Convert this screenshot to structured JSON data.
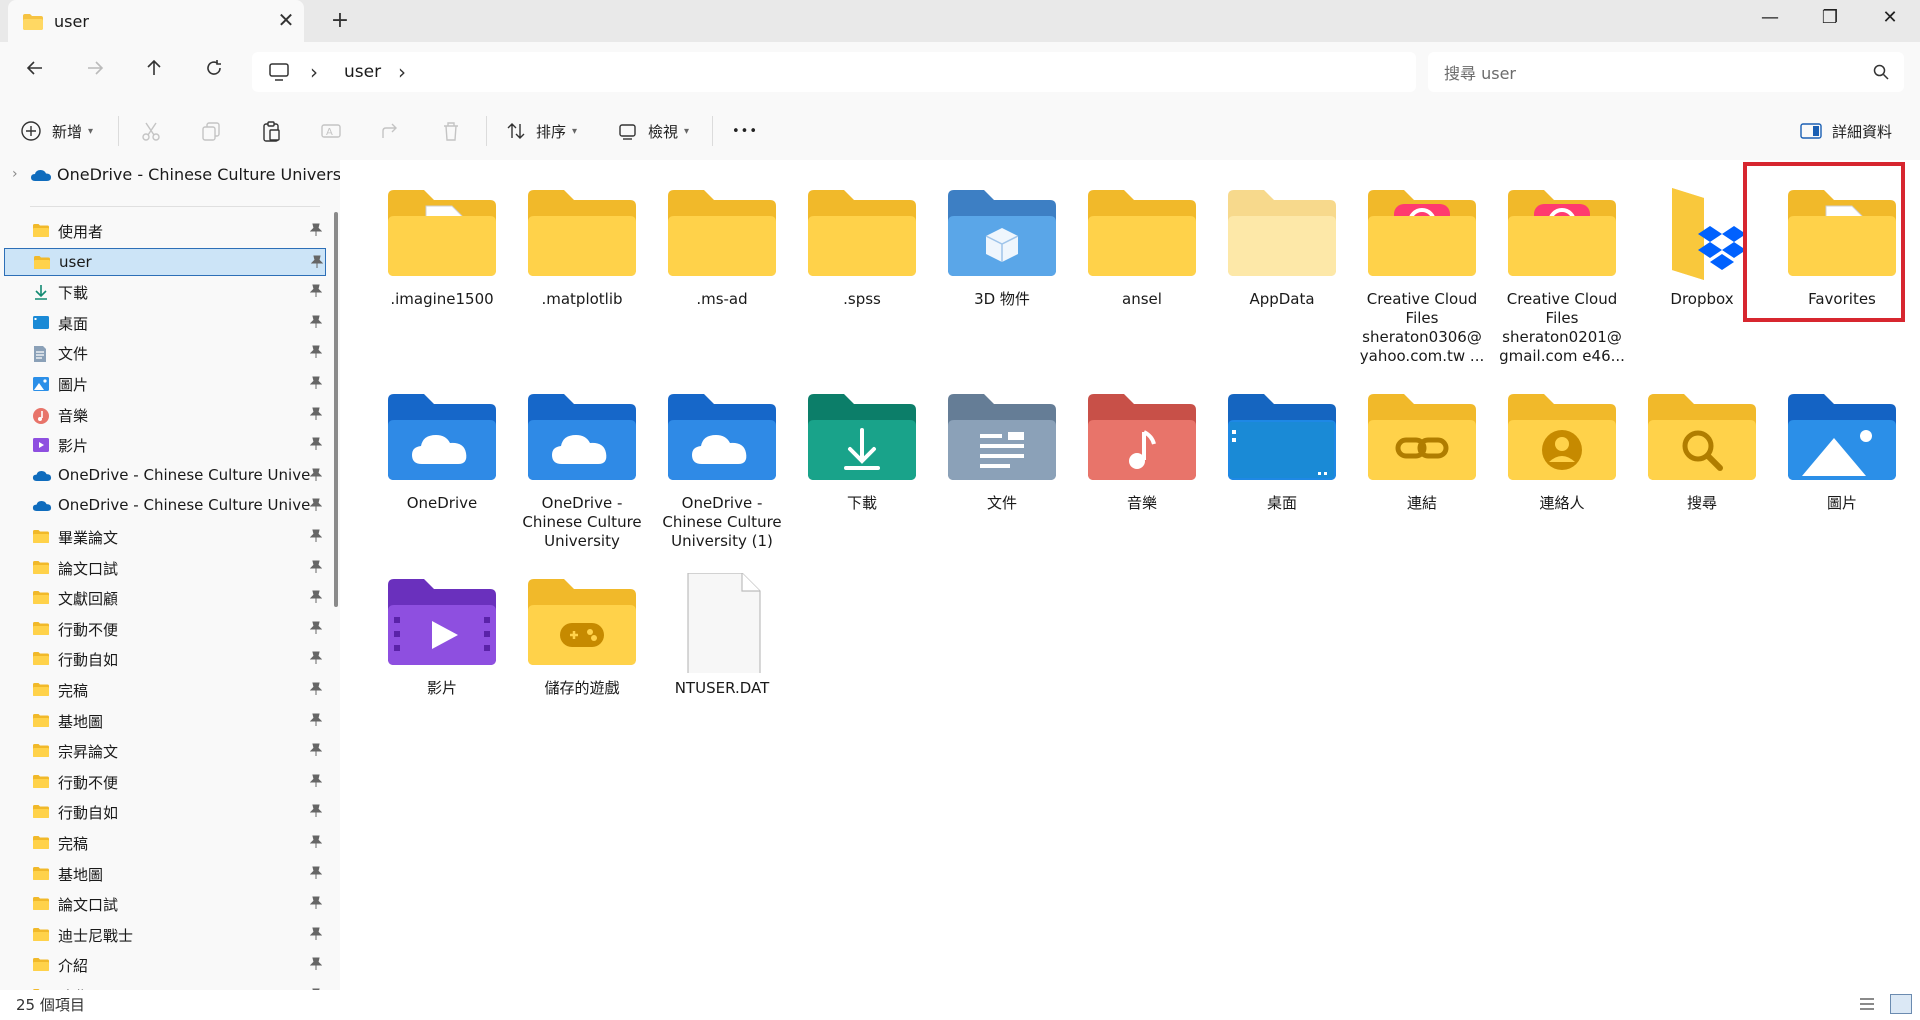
{
  "window": {
    "tab_title": "user",
    "new_tab": "+",
    "close_tab": "✕",
    "minimize": "—",
    "restore": "❐",
    "close": "✕"
  },
  "address": {
    "crumb": "user",
    "search_placeholder": "搜尋 user"
  },
  "commands": {
    "new_label": "新增",
    "sort_label": "排序",
    "view_label": "檢視",
    "more": "•••",
    "details_label": "詳細資料"
  },
  "sidebar": {
    "top_label": "OneDrive - Chinese Culture University",
    "items": [
      {
        "label": "使用者",
        "icon": "folder-icon"
      },
      {
        "label": "user",
        "icon": "folder-icon",
        "selected": true
      },
      {
        "label": "下載",
        "icon": "download-icon"
      },
      {
        "label": "桌面",
        "icon": "desktop-icon"
      },
      {
        "label": "文件",
        "icon": "document-icon"
      },
      {
        "label": "圖片",
        "icon": "pictures-icon"
      },
      {
        "label": "音樂",
        "icon": "music-icon"
      },
      {
        "label": "影片",
        "icon": "videos-icon"
      },
      {
        "label": "OneDrive - Chinese Culture University",
        "icon": "onedrive-icon"
      },
      {
        "label": "OneDrive - Chinese Culture University",
        "icon": "onedrive-icon"
      },
      {
        "label": "畢業論文",
        "icon": "folder-icon"
      },
      {
        "label": "論文口試",
        "icon": "folder-icon"
      },
      {
        "label": "文獻回顧",
        "icon": "folder-icon"
      },
      {
        "label": "行動不便",
        "icon": "folder-icon"
      },
      {
        "label": "行動自如",
        "icon": "folder-icon"
      },
      {
        "label": "完稿",
        "icon": "folder-icon"
      },
      {
        "label": "基地圖",
        "icon": "folder-icon"
      },
      {
        "label": "宗昇論文",
        "icon": "folder-icon"
      },
      {
        "label": "行動不便",
        "icon": "folder-icon"
      },
      {
        "label": "行動自如",
        "icon": "folder-icon"
      },
      {
        "label": "完稿",
        "icon": "folder-icon"
      },
      {
        "label": "基地圖",
        "icon": "folder-icon"
      },
      {
        "label": "論文口試",
        "icon": "folder-icon"
      },
      {
        "label": "迪士尼戰士",
        "icon": "folder-icon"
      },
      {
        "label": "介紹",
        "icon": "folder-icon"
      },
      {
        "label": "歌曲",
        "icon": "folder-icon"
      }
    ]
  },
  "files": [
    {
      "name": ".imagine1500",
      "icon": "folder-doc-icon"
    },
    {
      "name": ".matplotlib",
      "icon": "folder-icon"
    },
    {
      "name": ".ms-ad",
      "icon": "folder-icon"
    },
    {
      "name": ".spss",
      "icon": "folder-icon"
    },
    {
      "name": "3D 物件",
      "icon": "3d-objects-icon"
    },
    {
      "name": "ansel",
      "icon": "folder-icon"
    },
    {
      "name": "AppData",
      "icon": "folder-hidden-icon"
    },
    {
      "name": "Creative Cloud Files sheraton0306@ yahoo.com.tw ...",
      "icon": "creative-cloud-folder-icon"
    },
    {
      "name": "Creative Cloud Files sheraton0201@ gmail.com e46...",
      "icon": "creative-cloud-folder-icon"
    },
    {
      "name": "Dropbox",
      "icon": "dropbox-folder-icon"
    },
    {
      "name": "Favorites",
      "icon": "folder-doc-icon"
    },
    {
      "name": "OneDrive",
      "icon": "onedrive-folder-icon"
    },
    {
      "name": "OneDrive - Chinese Culture University",
      "icon": "onedrive-folder-icon"
    },
    {
      "name": "OneDrive - Chinese Culture University (1)",
      "icon": "onedrive-folder-icon"
    },
    {
      "name": "下載",
      "icon": "downloads-folder-icon"
    },
    {
      "name": "文件",
      "icon": "documents-folder-icon"
    },
    {
      "name": "音樂",
      "icon": "music-folder-icon"
    },
    {
      "name": "桌面",
      "icon": "desktop-folder-icon"
    },
    {
      "name": "連結",
      "icon": "links-folder-icon"
    },
    {
      "name": "連絡人",
      "icon": "contacts-folder-icon"
    },
    {
      "name": "搜尋",
      "icon": "searches-folder-icon"
    },
    {
      "name": "圖片",
      "icon": "pictures-folder-icon"
    },
    {
      "name": "影片",
      "icon": "videos-folder-icon"
    },
    {
      "name": "儲存的遊戲",
      "icon": "saved-games-folder-icon"
    },
    {
      "name": "NTUSER.DAT",
      "icon": "file-icon"
    }
  ],
  "status": {
    "item_count": "25 個項目"
  },
  "colors": {
    "highlight": "#d7262f",
    "selection": "#cce4f7",
    "folder": "#f6c342"
  }
}
